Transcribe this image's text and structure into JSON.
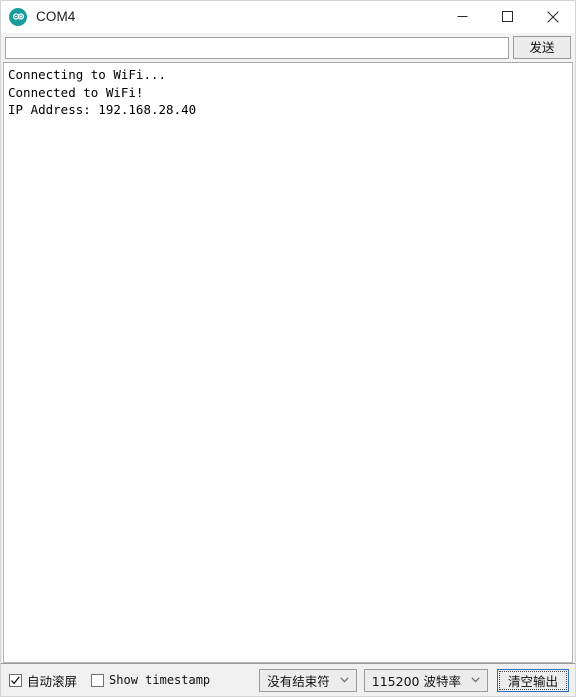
{
  "window": {
    "title": "COM4",
    "icon": "arduino-logo-icon",
    "accent_color": "#1a9c9c",
    "controls": {
      "minimize": "minimize-icon",
      "maximize": "maximize-icon",
      "close": "close-icon"
    }
  },
  "send_bar": {
    "input_value": "",
    "input_placeholder": "",
    "send_label": "发送"
  },
  "console": {
    "lines": [
      "Connecting to WiFi...",
      "Connected to WiFi!",
      "IP Address: 192.168.28.40"
    ],
    "text": "Connecting to WiFi...\nConnected to WiFi!\nIP Address: 192.168.28.40"
  },
  "status_bar": {
    "autoscroll": {
      "label": "自动滚屏",
      "checked": true
    },
    "timestamp": {
      "label": "Show timestamp",
      "checked": false
    },
    "line_ending": {
      "selected": "没有结束符",
      "arrow": "chevron-down-icon"
    },
    "baud_rate": {
      "selected": "115200 波特率",
      "arrow": "chevron-down-icon"
    },
    "clear_button": {
      "label": "清空输出",
      "focused": true,
      "focus_color": "#2f6fc0"
    }
  }
}
